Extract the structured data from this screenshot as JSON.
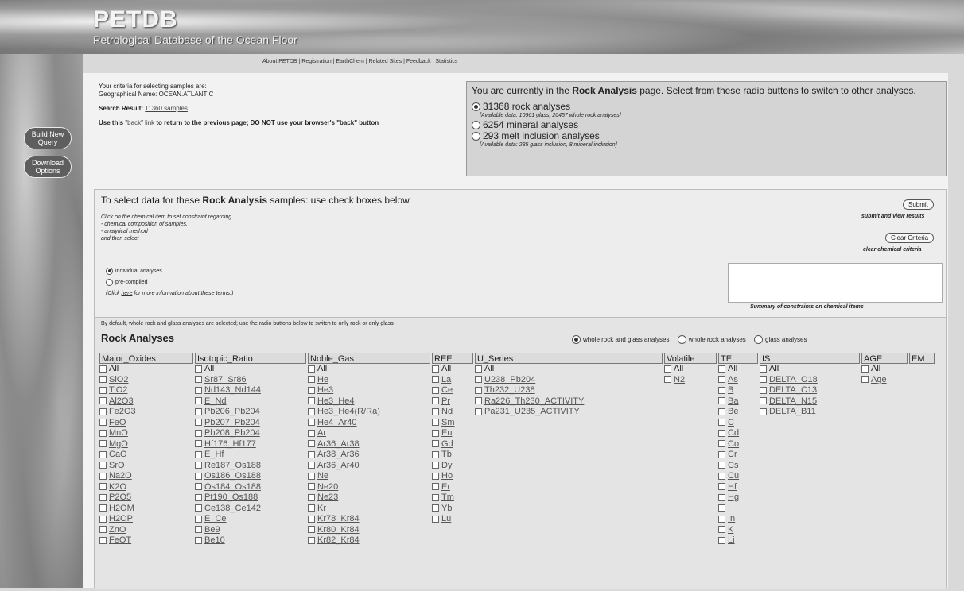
{
  "header": {
    "logo": "PETDB",
    "subtitle": "Petrological Database of the Ocean Floor"
  },
  "nav": {
    "links": [
      "About PETDB",
      "Registration",
      "EarthChem",
      "Related Sites",
      "Feedback",
      "Statistics"
    ],
    "separator": " | "
  },
  "sidebar": {
    "build_query": "Build New Query",
    "download": "Download Options"
  },
  "criteria": {
    "line1": "Your criteria for selecting samples are:",
    "line2": "Geographical Name: OCEAN.ATLANTIC",
    "search_label": "Search Result:",
    "search_value": "11360 samples",
    "back_prefix": "Use this ",
    "back_link": "\"back\" link",
    "back_suffix": " to return to the previous page; DO NOT use your browser's \"back\" button"
  },
  "rockbox": {
    "intro_pre": "You are currently in the ",
    "intro_bold": "Rock Analysis",
    "intro_post": " page. Select from these radio buttons to switch to other analyses.",
    "opt1": "31368 rock analyses",
    "opt1_note": "[Available data: 10961 glass, 20457 whole rock analyses]",
    "opt2": "6254 mineral analyses",
    "opt3": "293 melt inclusion analyses",
    "opt3_note": "[Available data: 285 glass inclusion, 8 mineral inclusion]"
  },
  "selection": {
    "head_pre": "To select data for these ",
    "head_bold": "Rock Analysis",
    "head_post": " samples: use check boxes below",
    "instr1": "Click on the chemical item to set constraint regarding",
    "instr2": "- chemical composition of samples.",
    "instr3": "- analytical method",
    "instr4": "and then select",
    "submit": "Submit",
    "submit_note": "submit and view results",
    "clear": "Clear Criteria",
    "clear_note": "clear chemical criteria",
    "individual": "individual analyses",
    "precompiled": "pre-compiled",
    "more_pre": "(Click ",
    "more_link": "here",
    "more_post": " for more information about these terms.)",
    "summary_label": "Summary of constraints on chemical items"
  },
  "rock_analyses": {
    "default_note": "By default, whole rock and glass analyses are selected; use the radio buttons below to switch to only rock or only glass",
    "title": "Rock Analyses",
    "type_options": [
      "whole rock and glass analyses",
      "whole rock analyses",
      "glass analyses"
    ],
    "columns": [
      {
        "header": "Major_Oxides",
        "items": [
          "All",
          "SiO2",
          "TiO2",
          "Al2O3",
          "Fe2O3",
          "FeO",
          "MnO",
          "MgO",
          "CaO",
          "SrO",
          "Na2O",
          "K2O",
          "P2O5",
          "H2OM",
          "H2OP",
          "ZnO",
          "FeOT"
        ]
      },
      {
        "header": "Isotopic_Ratio",
        "items": [
          "All",
          "Sr87_Sr86",
          "Nd143_Nd144",
          "E_Nd",
          "Pb206_Pb204",
          "Pb207_Pb204",
          "Pb208_Pb204",
          "Hf176_Hf177",
          "E_Hf",
          "Re187_Os188",
          "Os186_Os188",
          "Os184_Os188",
          "Pt190_Os188",
          "Ce138_Ce142",
          "E_Ce",
          "Be9",
          "Be10"
        ]
      },
      {
        "header": "Noble_Gas",
        "items": [
          "All",
          "He",
          "He3",
          "He3_He4",
          "He3_He4(R/Ra)",
          "He4_Ar40",
          "Ar",
          "Ar36_Ar38",
          "Ar38_Ar36",
          "Ar36_Ar40",
          "Ne",
          "Ne20",
          "Ne23",
          "Kr",
          "Kr78_Kr84",
          "Kr80_Kr84",
          "Kr82_Kr84"
        ]
      },
      {
        "header": "REE",
        "items": [
          "All",
          "La",
          "Ce",
          "Pr",
          "Nd",
          "Sm",
          "Eu",
          "Gd",
          "Tb",
          "Dy",
          "Ho",
          "Er",
          "Tm",
          "Yb",
          "Lu"
        ]
      },
      {
        "header": "U_Series",
        "items": [
          "All",
          "U238_Pb204",
          "Th232_U238",
          "Ra226_Th230_ACTIVITY",
          "Pa231_U235_ACTIVITY"
        ]
      },
      {
        "header": "Volatile",
        "items": [
          "All",
          "N2"
        ]
      },
      {
        "header": "TE",
        "items": [
          "All",
          "As",
          "B",
          "Ba",
          "Be",
          "C",
          "Cd",
          "Co",
          "Cr",
          "Cs",
          "Cu",
          "Hf",
          "Hg",
          "I",
          "In",
          "K",
          "Li"
        ]
      },
      {
        "header": "IS",
        "items": [
          "All",
          "DELTA_O18",
          "DELTA_C13",
          "DELTA_N15",
          "DELTA_B11"
        ]
      },
      {
        "header": "AGE",
        "items": [
          "All",
          "Age"
        ]
      },
      {
        "header": "EM",
        "items": []
      }
    ]
  }
}
